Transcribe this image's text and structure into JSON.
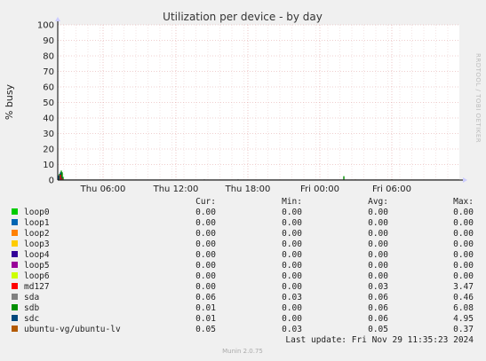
{
  "chart_data": {
    "type": "area",
    "title": "Utilization per device - by day",
    "ylabel": "% busy",
    "ylim": [
      0,
      100
    ],
    "yticks": [
      0,
      10,
      20,
      30,
      40,
      50,
      60,
      70,
      80,
      90,
      100
    ],
    "xticks": [
      "Thu 06:00",
      "Thu 12:00",
      "Thu 18:00",
      "Fri 00:00",
      "Fri 06:00"
    ],
    "grid": true,
    "side_label": "RRDTOOL / TOBI OETIKER",
    "columns": [
      "Cur:",
      "Min:",
      "Avg:",
      "Max:"
    ],
    "series": [
      {
        "name": "loop0",
        "color": "#00cc00",
        "cur": "0.00",
        "min": "0.00",
        "avg": "0.00",
        "max": "0.00"
      },
      {
        "name": "loop1",
        "color": "#0066b3",
        "cur": "0.00",
        "min": "0.00",
        "avg": "0.00",
        "max": "0.00"
      },
      {
        "name": "loop2",
        "color": "#ff8000",
        "cur": "0.00",
        "min": "0.00",
        "avg": "0.00",
        "max": "0.00"
      },
      {
        "name": "loop3",
        "color": "#ffcc00",
        "cur": "0.00",
        "min": "0.00",
        "avg": "0.00",
        "max": "0.00"
      },
      {
        "name": "loop4",
        "color": "#330099",
        "cur": "0.00",
        "min": "0.00",
        "avg": "0.00",
        "max": "0.00"
      },
      {
        "name": "loop5",
        "color": "#990099",
        "cur": "0.00",
        "min": "0.00",
        "avg": "0.00",
        "max": "0.00"
      },
      {
        "name": "loop6",
        "color": "#ccff00",
        "cur": "0.00",
        "min": "0.00",
        "avg": "0.00",
        "max": "0.00"
      },
      {
        "name": "md127",
        "color": "#ff0000",
        "cur": "0.00",
        "min": "0.00",
        "avg": "0.03",
        "max": "3.47"
      },
      {
        "name": "sda",
        "color": "#808080",
        "cur": "0.06",
        "min": "0.03",
        "avg": "0.06",
        "max": "0.46"
      },
      {
        "name": "sdb",
        "color": "#008f00",
        "cur": "0.01",
        "min": "0.00",
        "avg": "0.06",
        "max": "6.08"
      },
      {
        "name": "sdc",
        "color": "#00487d",
        "cur": "0.01",
        "min": "0.00",
        "avg": "0.06",
        "max": "4.95"
      },
      {
        "name": "ubuntu-vg/ubuntu-lv",
        "color": "#b35a00",
        "cur": "0.05",
        "min": "0.03",
        "avg": "0.05",
        "max": "0.37"
      }
    ],
    "last_update": "Last update: Fri Nov 29 11:35:23 2024",
    "footer": "Munin 2.0.75"
  }
}
